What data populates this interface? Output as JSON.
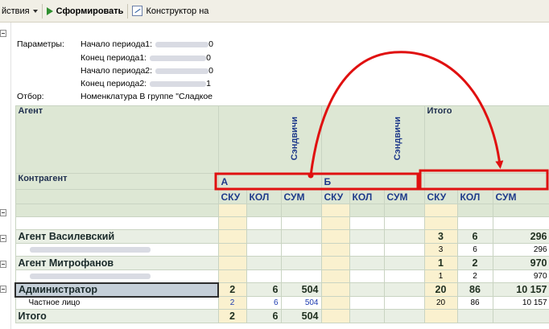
{
  "toolbar": {
    "actions_label": "йствия",
    "generate_label": "Сформировать",
    "builder_label": "Конструктор на"
  },
  "params": {
    "params_label": "Параметры:",
    "start1_label": "Начало периода1:",
    "start1_value": "0",
    "end1_label": "Конец периода1:",
    "end1_value": "0",
    "start2_label": "Начало периода2:",
    "start2_value": "0",
    "end2_label": "Конец периода2:",
    "end2_value": "1",
    "filter_label": "Отбор:",
    "filter_value": "Номенклатура В группе \"Сладкое"
  },
  "table": {
    "agent_header": "Агент",
    "counterparty_header": "Контрагент",
    "group_a": {
      "vertical_label": "Сэндвичи",
      "letter": "А"
    },
    "group_b": {
      "vertical_label": "Сэндвичи",
      "letter": "Б"
    },
    "total_header": "Итого",
    "cols": [
      "СКУ",
      "КОЛ",
      "СУМ"
    ],
    "rows": [
      {
        "name": "Агент Василевский",
        "a": [
          "",
          "",
          ""
        ],
        "b": [
          "",
          "",
          ""
        ],
        "t": [
          "3",
          "6",
          "296"
        ]
      },
      {
        "name": "",
        "a": [
          "",
          "",
          ""
        ],
        "b": [
          "",
          "",
          ""
        ],
        "t": [
          "3",
          "6",
          "296"
        ]
      },
      {
        "name": "Агент Митрофанов",
        "a": [
          "",
          "",
          ""
        ],
        "b": [
          "",
          "",
          ""
        ],
        "t": [
          "1",
          "2",
          "970"
        ]
      },
      {
        "name": "",
        "a": [
          "",
          "",
          ""
        ],
        "b": [
          "",
          "",
          ""
        ],
        "t": [
          "1",
          "2",
          "970"
        ]
      },
      {
        "name": "Администратор",
        "a": [
          "2",
          "6",
          "504"
        ],
        "b": [
          "",
          "",
          ""
        ],
        "t": [
          "20",
          "86",
          "10 157"
        ]
      },
      {
        "name": "Частное лицо",
        "a": [
          "2",
          "6",
          "504"
        ],
        "b": [
          "",
          "",
          ""
        ],
        "t": [
          "20",
          "86",
          "10 157"
        ]
      },
      {
        "name": "Итого",
        "a": [
          "2",
          "6",
          "504"
        ],
        "b": [
          "",
          "",
          ""
        ],
        "t": [
          "",
          "",
          ""
        ]
      }
    ]
  },
  "colors": {
    "header_bg": "#dde7d4",
    "group_row_bg": "#e9efe4",
    "yellow_col": "#faf1cf",
    "annotation_red": "#e01010"
  }
}
